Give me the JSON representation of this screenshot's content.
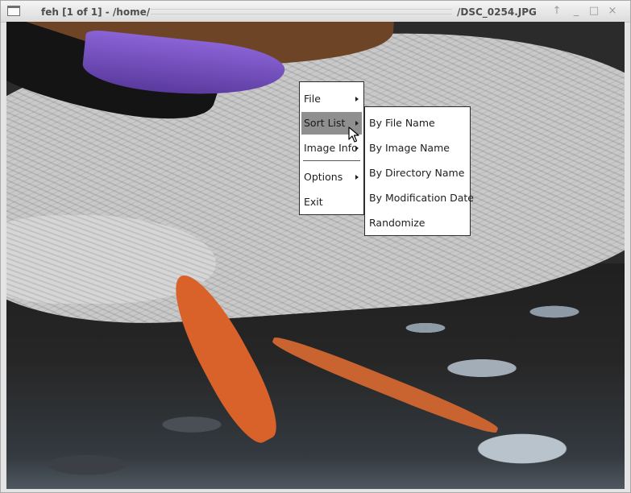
{
  "window": {
    "title_left": "feh [1 of 1] - /home/",
    "title_right": "/DSC_0254.JPG",
    "buttons": {
      "up": "↑",
      "minimize": "_",
      "maximize": "□",
      "close": "×"
    }
  },
  "context_menu": {
    "items": [
      {
        "label": "File",
        "has_submenu": true
      },
      {
        "label": "Sort List",
        "has_submenu": true,
        "active": true
      },
      {
        "label": "Image Info",
        "has_submenu": true
      },
      {
        "label": "Options",
        "has_submenu": true
      },
      {
        "label": "Exit",
        "has_submenu": false
      }
    ]
  },
  "submenu_sort_list": {
    "items": [
      {
        "label": "By File Name"
      },
      {
        "label": "By Image Name"
      },
      {
        "label": "By Directory Name"
      },
      {
        "label": "By Modification Date"
      },
      {
        "label": "Randomize"
      }
    ]
  },
  "icons": {
    "window_menu": "window-menu-icon",
    "submenu_arrow": "triangle-right-icon",
    "cursor": "mouse-pointer-icon"
  },
  "colors": {
    "menu_highlight": "#8f8f8f",
    "menu_background": "#ffffff",
    "menu_border": "#2c2c2c"
  }
}
